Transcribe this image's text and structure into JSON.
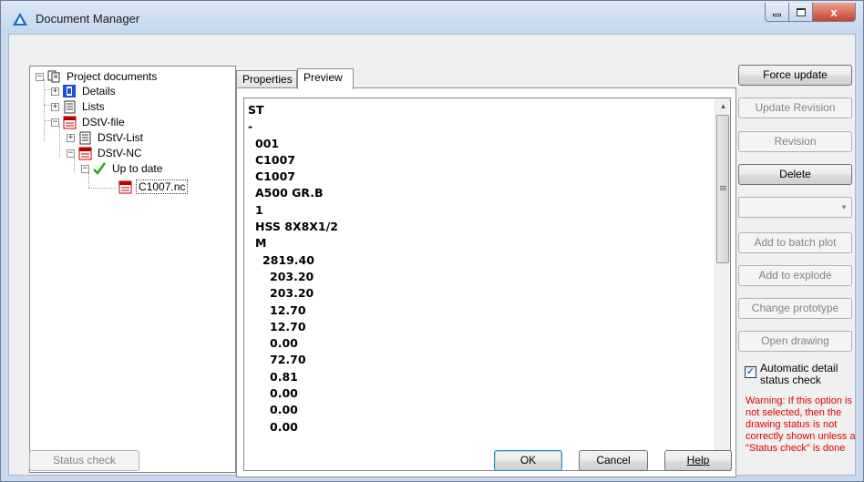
{
  "window": {
    "title": "Document Manager"
  },
  "title_buttons": {
    "close": "x"
  },
  "tree": {
    "root": "Project documents",
    "details": "Details",
    "lists": "Lists",
    "dstv_file": "DStV-file",
    "dstv_list": "DStV-List",
    "dstv_nc": "DStV-NC",
    "up_to_date": "Up to date",
    "file": "C1007.nc"
  },
  "tabs": {
    "properties": "Properties",
    "preview": "Preview"
  },
  "preview": {
    "lines": [
      "ST",
      "-",
      "001",
      "C1007",
      "C1007",
      "A500 GR.B",
      "1",
      "HSS 8X8X1/2",
      "M",
      "2819.40",
      "203.20",
      "203.20",
      "12.70",
      "12.70",
      "0.00",
      "72.70",
      "0.81",
      "0.00",
      "0.00",
      "0.00"
    ]
  },
  "buttons": {
    "force_update": "Force update",
    "update_revision": "Update Revision",
    "revision": "Revision",
    "delete": "Delete",
    "add_batch_plot": "Add to batch plot",
    "add_explode": "Add to explode",
    "change_prototype": "Change prototype",
    "open_drawing": "Open drawing",
    "status_check": "Status check",
    "ok": "OK",
    "cancel": "Cancel",
    "help": "Help"
  },
  "combo": {
    "value": ""
  },
  "auto_check": {
    "label": "Automatic detail status check",
    "checked": true
  },
  "warning": "Warning: If this option is not selected, then the drawing status is not correctly shown unless a \"Status check\" is done",
  "colors": {
    "warning": "#e00000",
    "accent": "#3c7fb1"
  }
}
